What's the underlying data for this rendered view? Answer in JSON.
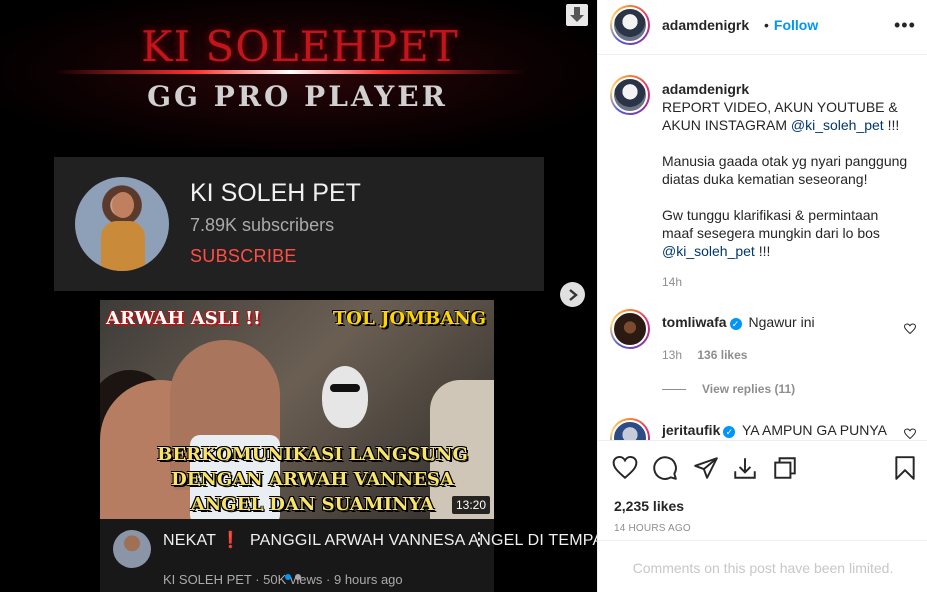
{
  "media": {
    "banner_title": "KI SOLEHPET",
    "banner_subtitle": "GG PRO PLAYER",
    "channel": {
      "name": "KI SOLEH PET",
      "subscribers": "7.89K subscribers",
      "subscribe_label": "SUBSCRIBE"
    },
    "video": {
      "tag_left": "ARWAH ASLI !!",
      "tag_right": "TOL JOMBANG",
      "headline": "BERKOMUNIKASI LANGSUNG DENGAN ARWAH VANNESA ANGEL DAN SUAMINYA",
      "duration": "13:20",
      "title_prefix": "NEKAT",
      "title_mark": "❗",
      "title_rest": "PANGGIL ARWAH VANNESA ANGEL DI TEMPAT TERJA...",
      "meta": "KI SOLEH PET · 50K views · 9 hours ago"
    },
    "carousel": {
      "count": 2,
      "active_index": 1
    }
  },
  "post": {
    "username": "adamdenigrk",
    "dot": "•",
    "follow_label": "Follow",
    "more_icon": "more-horizontal-icon",
    "caption": {
      "username": "adamdenigrk",
      "p1": "REPORT VIDEO, AKUN YOUTUBE & AKUN INSTAGRAM ",
      "p1_mention": "@ki_soleh_pet",
      "p1_tail": " !!!",
      "p2": "Manusia gaada otak yg nyari panggung diatas duka kematian seseorang!",
      "p3": "Gw tunggu klarifikasi & permintaan maaf sesegera mungkin dari lo bos ",
      "p3_mention": "@ki_soleh_pet",
      "p3_tail": " !!!",
      "time": "14h"
    },
    "comments": [
      {
        "username": "tomliwafa",
        "verified": true,
        "text": "Ngawur ini",
        "time": "13h",
        "likes": "136 likes",
        "replies": "View replies (11)"
      },
      {
        "username": "jeritaufik",
        "verified": true,
        "text": "YA AMPUN GA PUNYA"
      }
    ],
    "likes": "2,235 likes",
    "time_ago": "14 HOURS AGO",
    "comments_limited": "Comments on this post have been limited.",
    "colors": {
      "accent": "#0095f6",
      "muted": "#8e8e8e",
      "text": "#262626",
      "subscribe": "#ff4e45"
    }
  }
}
